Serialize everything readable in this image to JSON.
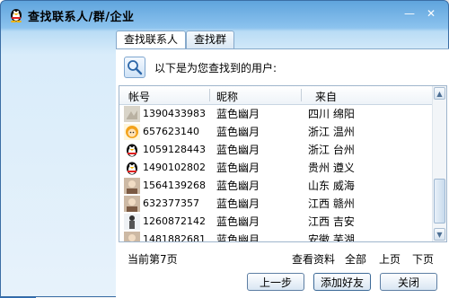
{
  "window": {
    "title": "查找联系人/群/企业",
    "minimize_glyph": "—",
    "close_glyph": "✕"
  },
  "tabs": [
    {
      "label": "查找联系人",
      "active": true
    },
    {
      "label": "查找群",
      "active": false
    }
  ],
  "info_text": "以下是为您查找到的用户:",
  "table": {
    "headers": [
      "帐号",
      "昵称",
      "来自"
    ],
    "rows": [
      {
        "id": "1390433983",
        "nick": "蓝色幽月",
        "location": "四川 绵阳",
        "avatar": "avatar-gray-icon"
      },
      {
        "id": "657623140",
        "nick": "蓝色幽月",
        "location": "浙江 温州",
        "avatar": "avatar-cartoon-icon"
      },
      {
        "id": "1059128443",
        "nick": "蓝色幽月",
        "location": "浙江 台州",
        "avatar": "penguin-icon"
      },
      {
        "id": "1490102802",
        "nick": "蓝色幽月",
        "location": "贵州 遵义",
        "avatar": "penguin-icon"
      },
      {
        "id": "1564139268",
        "nick": "蓝色幽月",
        "location": "山东 威海",
        "avatar": "avatar-photo-icon"
      },
      {
        "id": "632377357",
        "nick": "蓝色幽月",
        "location": "江西 赣州",
        "avatar": "avatar-photo-icon"
      },
      {
        "id": "1260872142",
        "nick": "蓝色幽月",
        "location": "江西 吉安",
        "avatar": "avatar-figure-icon"
      },
      {
        "id": "1481882681",
        "nick": "蓝色幽月",
        "location": "安徽 芜湖",
        "avatar": "avatar-photo-icon"
      }
    ],
    "scroll_up_glyph": "▲",
    "scroll_down_glyph": "▼"
  },
  "pagination": {
    "current_page_text": "当前第7页",
    "view_details": "查看资料",
    "all": "全部",
    "prev_page": "上页",
    "next_page": "下页"
  },
  "buttons": {
    "back": "上一步",
    "add_friend": "添加好友",
    "close": "关闭"
  },
  "colors": {
    "title_gradient_top": "#5fa4dd",
    "panel_border": "#86a9cb",
    "accent": "#3b6ea5"
  }
}
